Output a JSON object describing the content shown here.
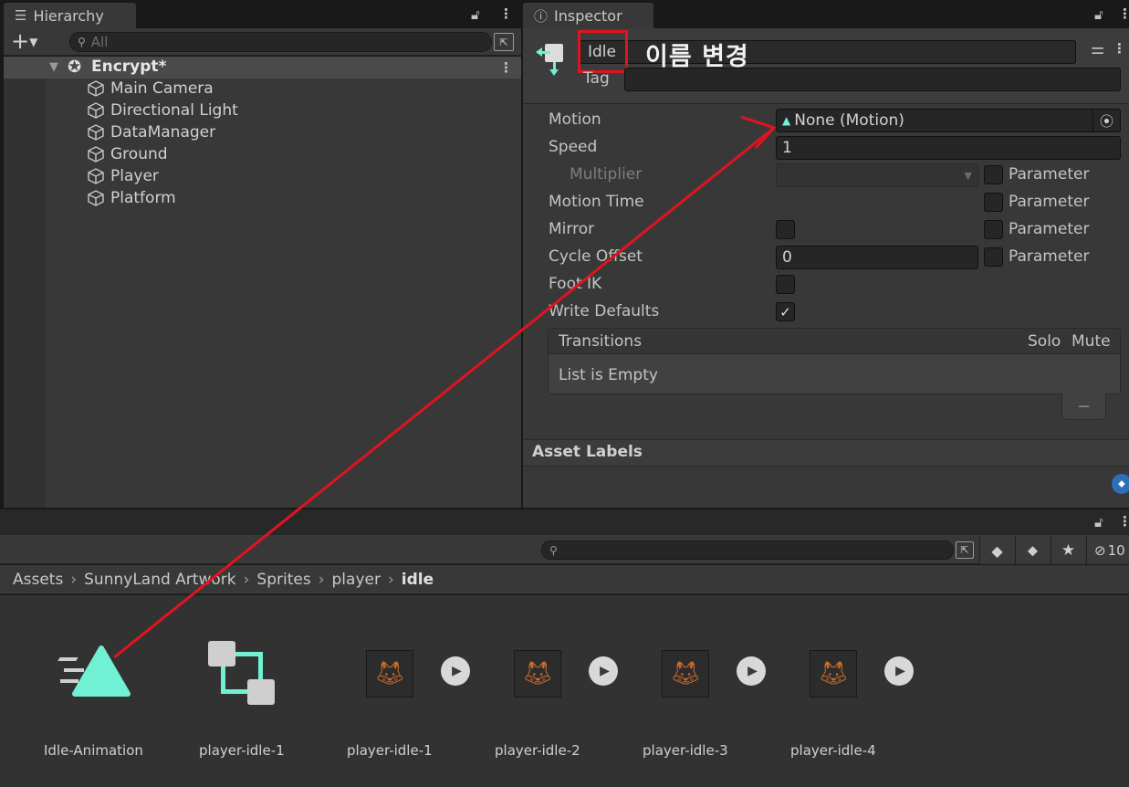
{
  "hierarchy": {
    "tab_label": "Hierarchy",
    "search_placeholder": "All",
    "scene_name": "Encrypt*",
    "items": [
      "Main Camera",
      "Directional Light",
      "DataManager",
      "Ground",
      "Player",
      "Platform"
    ]
  },
  "inspector": {
    "tab_label": "Inspector",
    "state_name": "Idle",
    "annotation": "이름 변경",
    "tag_label": "Tag",
    "rows": {
      "motion_label": "Motion",
      "motion_value": "None (Motion)",
      "speed_label": "Speed",
      "speed_value": "1",
      "multiplier_label": "Multiplier",
      "motion_time_label": "Motion Time",
      "mirror_label": "Mirror",
      "cycle_offset_label": "Cycle Offset",
      "cycle_offset_value": "0",
      "foot_ik_label": "Foot IK",
      "write_defaults_label": "Write Defaults",
      "parameter_label": "Parameter"
    },
    "transitions": {
      "title": "Transitions",
      "solo": "Solo",
      "mute": "Mute",
      "empty": "List is Empty",
      "remove": "−"
    },
    "asset_labels": "Asset Labels"
  },
  "project": {
    "breadcrumb": [
      "Assets",
      "SunnyLand Artwork",
      "Sprites",
      "player",
      "idle"
    ],
    "hidden_count": "10",
    "assets": [
      "Idle-Animation",
      "player-idle-1",
      "player-idle-1",
      "player-idle-2",
      "player-idle-3",
      "player-idle-4"
    ]
  },
  "colors": {
    "annotation_red": "#e0141e",
    "accent_teal": "#71f0d4",
    "panel_bg": "#383838",
    "field_bg": "#262626"
  }
}
